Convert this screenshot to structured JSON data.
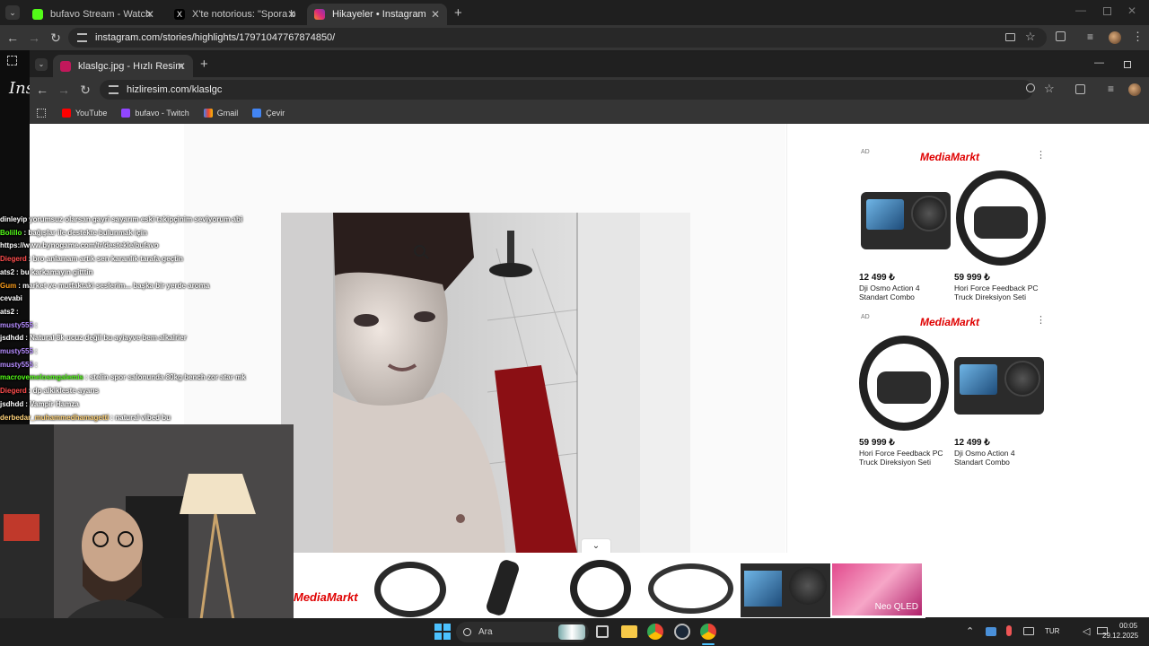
{
  "outer_tabs": [
    {
      "title": "bufavo Stream - Watch Live on",
      "color": "#53fc18"
    },
    {
      "title": "X'te notorious: \"Spora başlıcam",
      "color": "#000000"
    },
    {
      "title": "Hikayeler • Instagram",
      "color": "#e1306c"
    }
  ],
  "outer_url": "instagram.com/stories/highlights/17971047767874850/",
  "inner_tab": {
    "title": "klaslgc.jpg - Hızlı Resim"
  },
  "inner_url": "hizliresim.com/klaslgc",
  "bookmarks": [
    {
      "label": "YouTube",
      "color": "#ff0000"
    },
    {
      "label": "bufavo - Twitch",
      "color": "#9146ff"
    },
    {
      "label": "Gmail",
      "color": "#ea4335"
    },
    {
      "label": "Çevir",
      "color": "#4285f4"
    }
  ],
  "ads": [
    {
      "label": "AD",
      "brand": "MediaMarkt",
      "products": [
        {
          "price": "12 499 ₺",
          "name": "Dji Osmo Action 4 Standart Combo",
          "kind": "camera"
        },
        {
          "price": "59 999 ₺",
          "name": "Hori Force Feedback PC Truck Direksiyon Seti",
          "kind": "wheel"
        }
      ]
    },
    {
      "label": "AD",
      "brand": "MediaMarkt",
      "products": [
        {
          "price": "59 999 ₺",
          "name": "Hori Force Feedback PC Truck Direksiyon Seti",
          "kind": "wheel"
        },
        {
          "price": "12 499 ₺",
          "name": "Dji Osmo Action 4 Standart Combo",
          "kind": "camera"
        }
      ]
    }
  ],
  "chat": [
    {
      "user": "dinleyip",
      "color": "#ffffff",
      "msg": "yorumsuz olarsan gayri sayarım eski takipçinim seviyorum abi"
    },
    {
      "user": "Bolillo",
      "color": "#53fc18",
      "msg": ": bağışlar ile destekte bulunmak için"
    },
    {
      "user": "https://www.bynogame.com/tr/destekle/bufavo",
      "color": "#ffffff",
      "msg": ""
    },
    {
      "user": "Diegerd",
      "color": "#ff4d4d",
      "msg": ": bro anlamam artık sen karanlık tarafa geçtin"
    },
    {
      "user": "ats2",
      "color": "#ffffff",
      "msg": ": bu karkamayın gitttin"
    },
    {
      "user": "Gum",
      "color": "#ff9f1a",
      "msg": ": market ve mutfaktaki seslerim... başka bir yerde aroma"
    },
    {
      "user": "cevabi",
      "color": "#ffffff",
      "msg": ""
    },
    {
      "user": "ats2",
      "color": "#ffffff",
      "msg": ":"
    },
    {
      "user": "musty555",
      "color": "#b58cff",
      "msg": ":"
    },
    {
      "user": "jsdhdd",
      "color": "#ffffff",
      "msg": ": Natural 8k ucuz değil bu ayiayve bem alkalrier"
    },
    {
      "user": "musty555",
      "color": "#b58cff",
      "msg": ":"
    },
    {
      "user": "musty555",
      "color": "#b58cff",
      "msg": ":"
    },
    {
      "user": "macrovemelosmgalemis",
      "color": "#53fc18",
      "msg": ": stelin spor salonunda 80kg bench zor atar mk"
    },
    {
      "user": "Diegerd",
      "color": "#ff4d4d",
      "msg": ": dp alkikleste ayarıs"
    },
    {
      "user": "jsdhdd",
      "color": "#ffffff",
      "msg": ": Vampir Hamza"
    },
    {
      "user": "derbedar_muhammedhamagetti",
      "color": "#ffd37a",
      "msg": ": natural vibed bu"
    }
  ],
  "bottom_ad": {
    "brand": "MediaMarkt",
    "tv_label": "Neo QLED"
  },
  "collapse_icon": "chevron-down-icon",
  "taskbar": {
    "search_label": "Ara",
    "lang": "TUR",
    "time": "00:05",
    "date": "29.12.2025"
  }
}
